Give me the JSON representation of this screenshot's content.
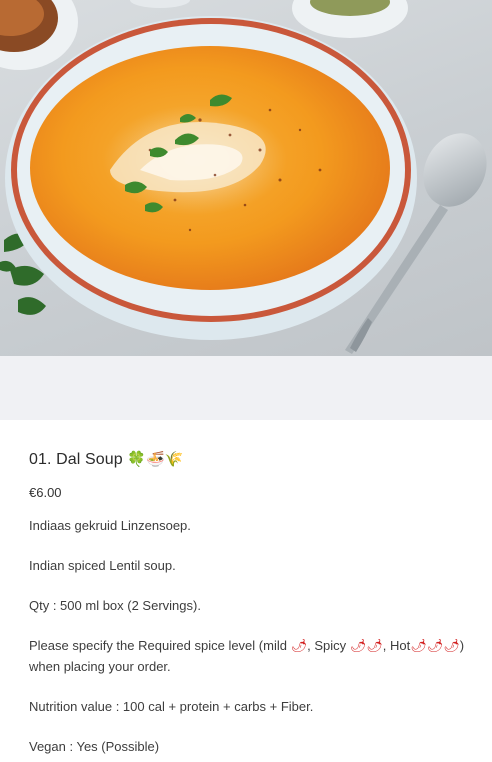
{
  "hero": {
    "image_alt": "Bowl of orange lentil soup with cream swirl and parsley"
  },
  "product": {
    "title": "01. Dal Soup",
    "title_emojis": "🍀🍜🌾",
    "price": "€6.00",
    "description": {
      "line_dutch": "Indiaas gekruid Linzensoep.",
      "line_english": "Indian spiced Lentil soup.",
      "qty": "Qty : 500 ml box (2 Servings).",
      "spice_intro": "Please specify the Required spice level (mild ",
      "spice_mild_icon": "🌶",
      "spice_spicy_label": ", Spicy ",
      "spice_spicy_icon": "🌶🌶",
      "spice_hot_label": ", Hot",
      "spice_hot_icon": "🌶🌶🌶",
      "spice_outro": ") when placing your order.",
      "nutrition": "Nutrition value : 100 cal + protein + carbs + Fiber.",
      "vegan": "Vegan : Yes (Possible)"
    }
  },
  "colors": {
    "soup": "#f39a1e",
    "bowl": "#dfeaf0",
    "bowl_rim": "#c9583b",
    "background_gap": "#f0f1f4"
  }
}
